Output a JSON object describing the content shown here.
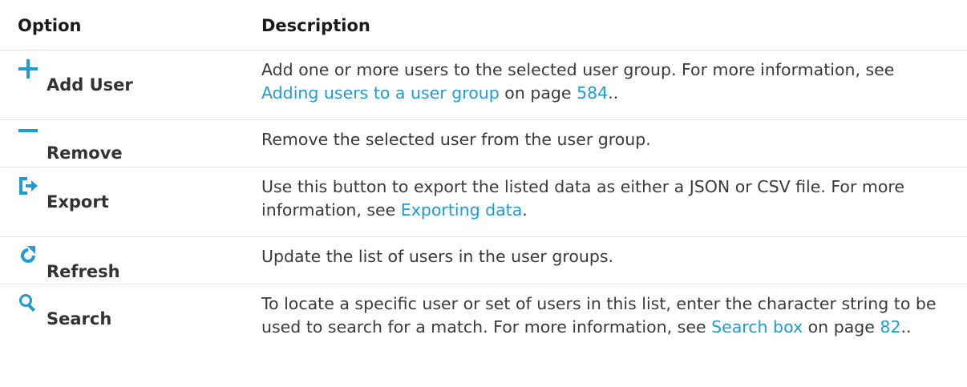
{
  "table": {
    "headers": {
      "option": "Option",
      "description": "Description"
    },
    "rows": [
      {
        "icon": "plus-icon",
        "label": "Add User",
        "desc_before_link1": "Add one or more users to the selected user group. For more information, see ",
        "link1": "Adding users to a user group",
        "desc_mid": " on page ",
        "link2": "584",
        "desc_after": ".."
      },
      {
        "icon": "minus-icon",
        "label": "Remove",
        "desc": "Remove the selected user from the user group."
      },
      {
        "icon": "export-icon",
        "label": "Export",
        "desc_before_link1": "Use this button to export the listed data as either a JSON or CSV file. For more information, see ",
        "link1": "Exporting data",
        "desc_after": "."
      },
      {
        "icon": "refresh-icon",
        "label": "Refresh",
        "desc": "Update the list of users in the user groups."
      },
      {
        "icon": "search-icon",
        "label": "Search",
        "desc_before_link1": "To locate a specific user or set of users in this list, enter the character string to be used to search for a match. For more information, see ",
        "link1": "Search box",
        "desc_mid": " on page ",
        "link2": "82",
        "desc_after": ".."
      }
    ]
  },
  "colors": {
    "icon_blue": "#1f9bd6",
    "link_blue": "#1f9bd6",
    "text": "#3a3a3a",
    "rule": "#e3e3e3"
  }
}
